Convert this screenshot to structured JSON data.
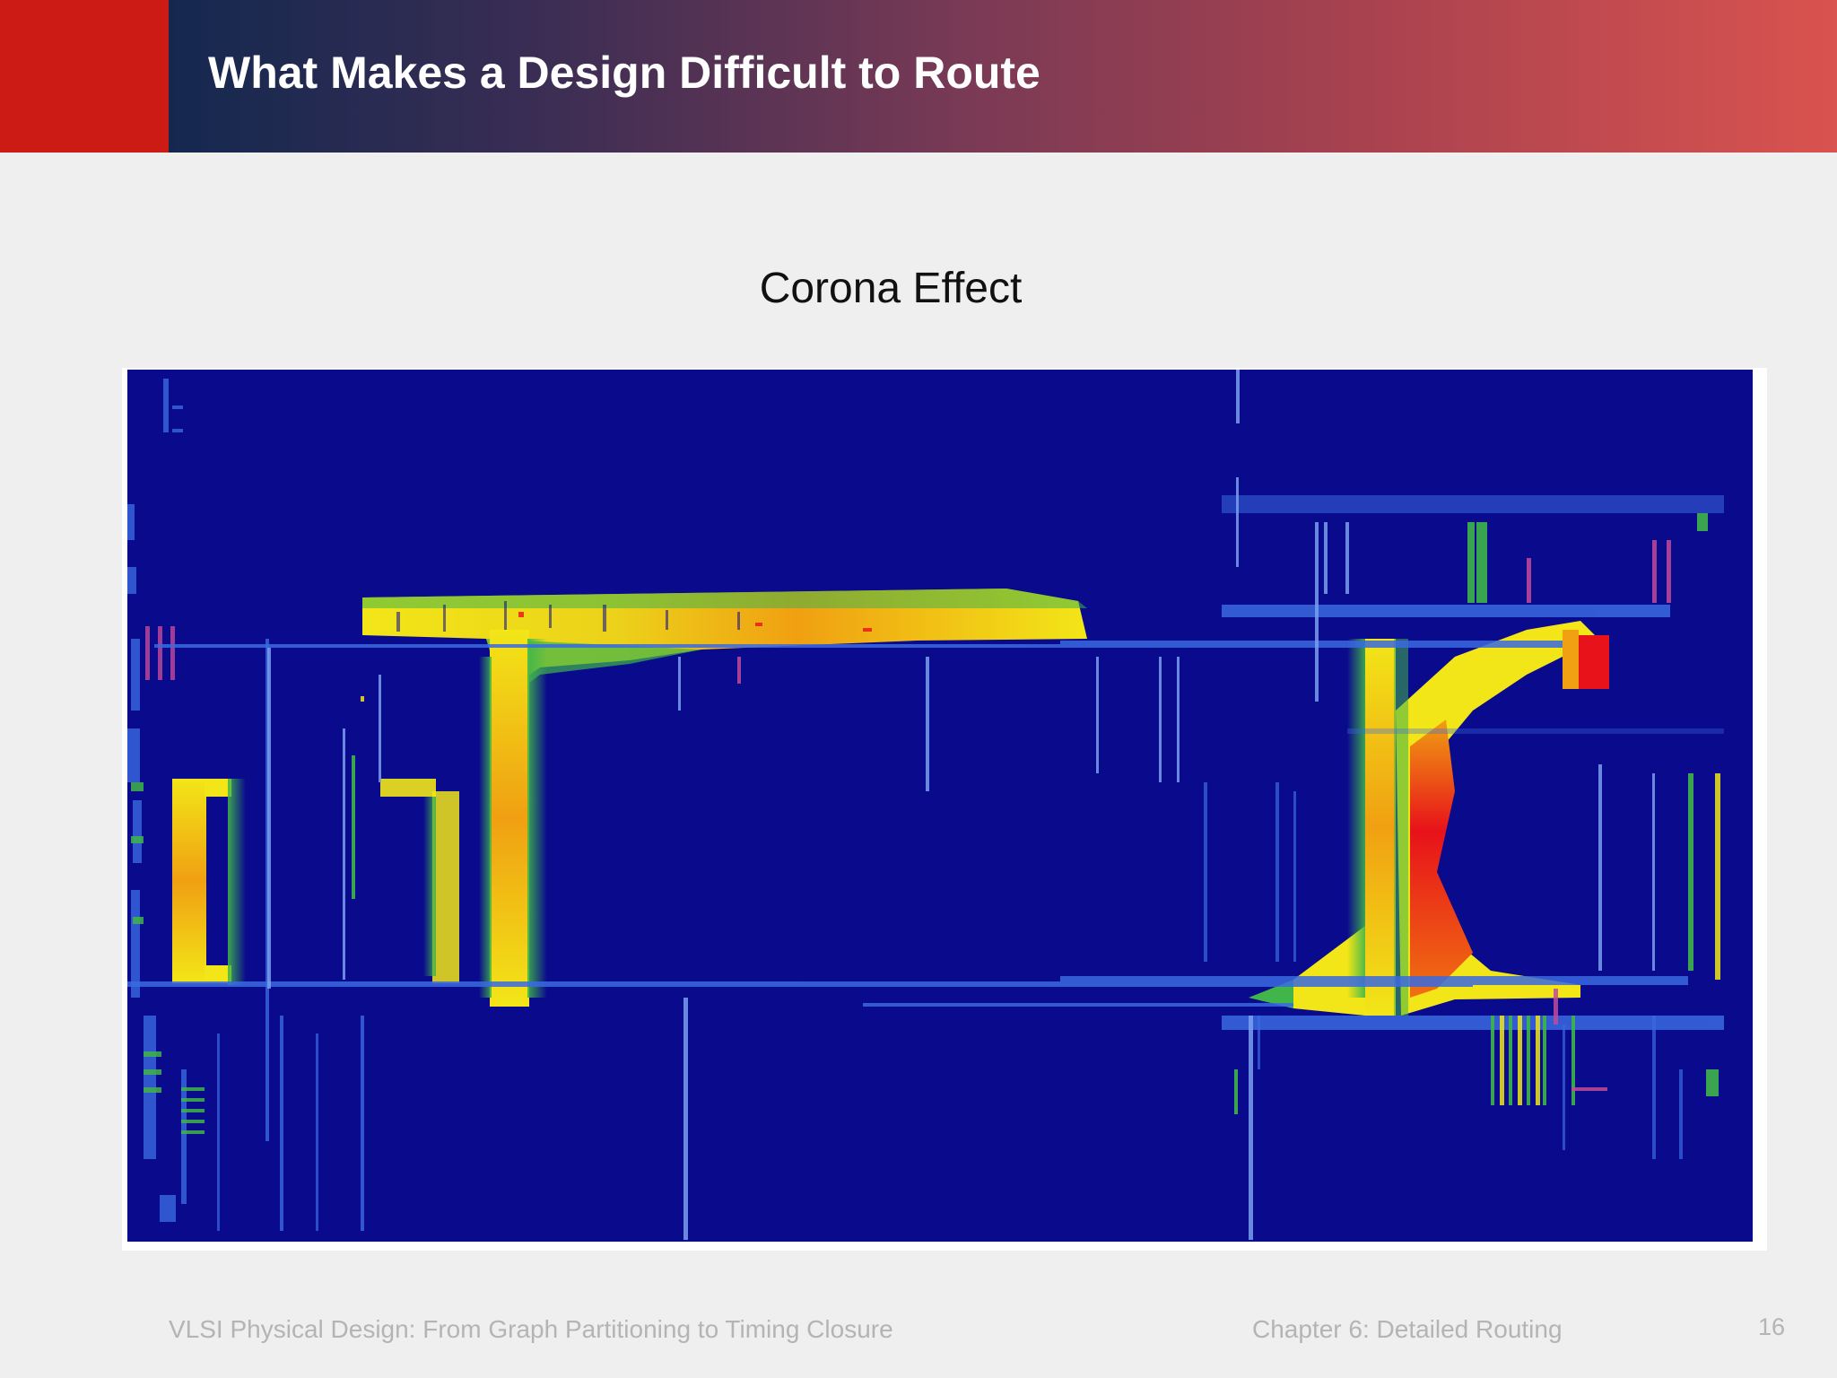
{
  "slide": {
    "title": "What Makes a Design Difficult to Route",
    "subtitle": "Corona Effect"
  },
  "figure": {
    "type": "routing congestion heatmap",
    "colors": {
      "background": "#0a0a8c",
      "low": "#1a3cd8",
      "medium": "#3fb54a",
      "high": "#f2e618",
      "very_high": "#f08a12",
      "critical": "#e8121a"
    }
  },
  "footer": {
    "book": "VLSI Physical Design: From Graph Partitioning to Timing Closure",
    "chapter": "Chapter 6: Detailed Routing",
    "page": "16"
  },
  "theme": {
    "header_accent": "#cc1a14",
    "header_gradient_start": "#14284f",
    "header_gradient_end": "#d9534f",
    "slide_background": "#efefef",
    "footer_text": "#b4b4b4"
  }
}
